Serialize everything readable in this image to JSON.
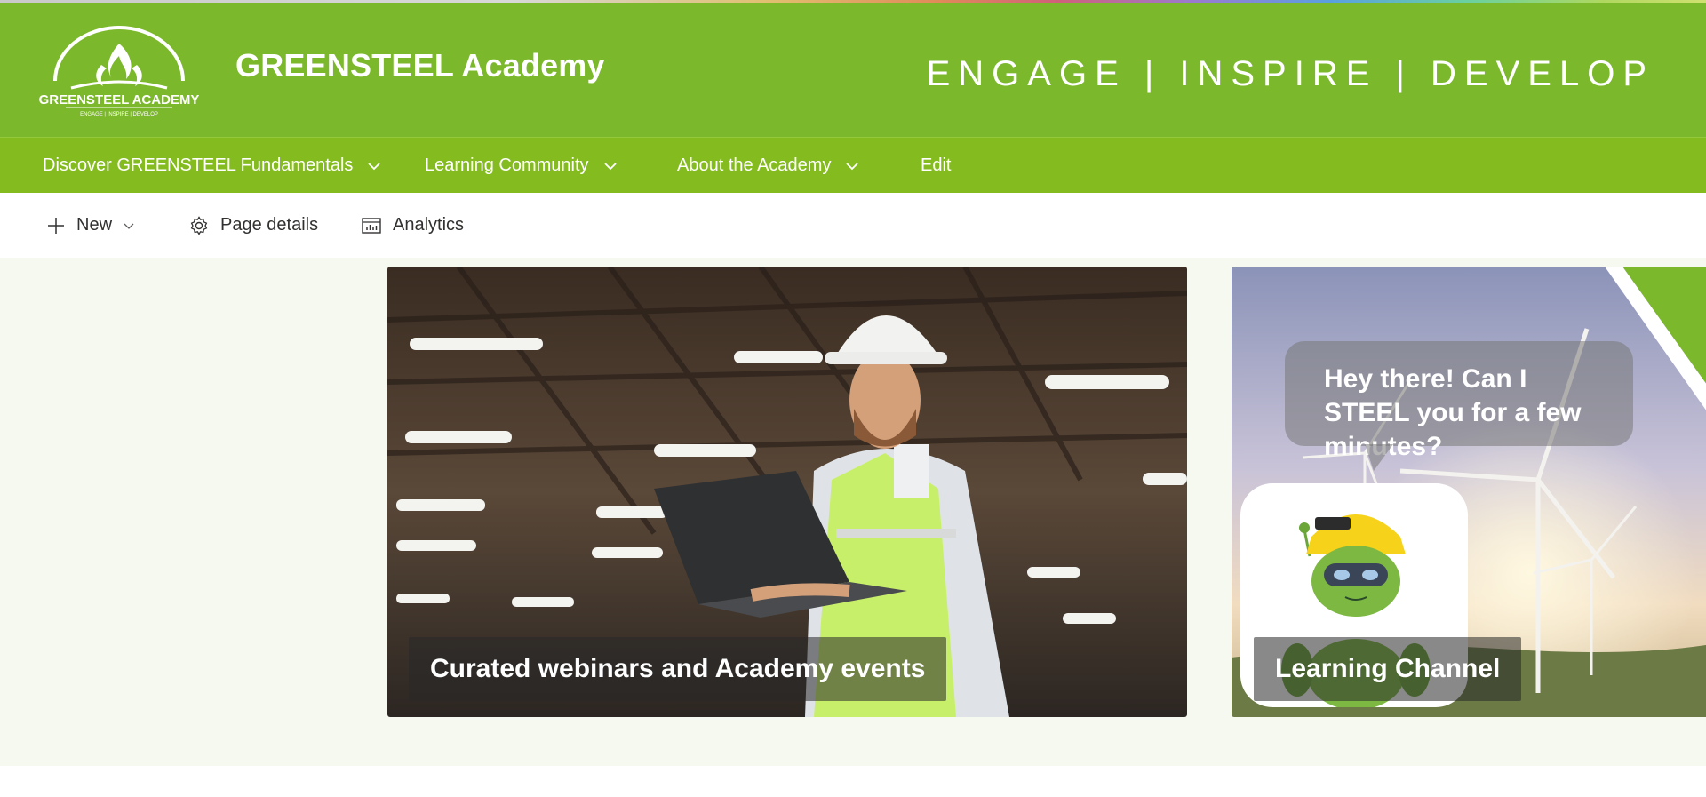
{
  "header": {
    "logo_text": "GREENSTEEL ACADEMY",
    "logo_subtext": "ENGAGE | INSPIRE | DEVELOP",
    "site_title": "GREENSTEEL Academy",
    "tagline": "ENGAGE | INSPIRE | DEVELOP"
  },
  "nav": {
    "items": [
      {
        "label": "Discover GREENSTEEL Fundamentals",
        "has_dropdown": true
      },
      {
        "label": "Learning Community",
        "has_dropdown": true
      },
      {
        "label": "About the Academy",
        "has_dropdown": true
      },
      {
        "label": "Edit",
        "has_dropdown": false
      }
    ]
  },
  "cmdbar": {
    "new_label": "New",
    "page_details_label": "Page details",
    "analytics_label": "Analytics"
  },
  "tiles": [
    {
      "caption": "Curated webinars and Academy events",
      "icon": "warehouse-worker-laptop-photo"
    },
    {
      "caption": "Learning Channel",
      "speech": "Hey there! Can I STEEL you for a few minutes?",
      "icon": "robot-mascot-wind-turbines-photo"
    }
  ],
  "colors": {
    "header_green": "#7cb82b",
    "nav_green": "#84bc1f",
    "content_bg": "#f6f9f0"
  }
}
